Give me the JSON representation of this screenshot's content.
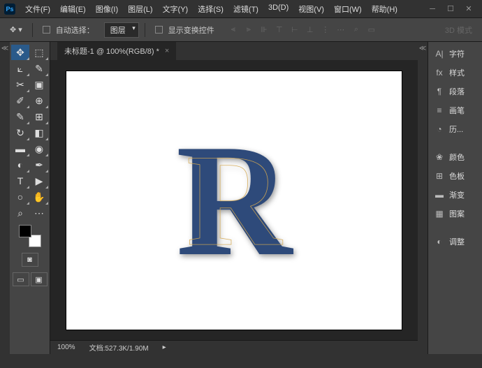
{
  "app": {
    "logo": "Ps"
  },
  "menu": {
    "file": "文件(F)",
    "edit": "编辑(E)",
    "image": "图像(I)",
    "layer": "图层(L)",
    "type": "文字(Y)",
    "select": "选择(S)",
    "filter": "滤镜(T)",
    "three_d": "3D(D)",
    "view": "视图(V)",
    "window": "窗口(W)",
    "help": "帮助(H)"
  },
  "options": {
    "auto_select": "自动选择：",
    "layer_dropdown": "图层",
    "show_transform": "显示变换控件",
    "three_d_mode": "3D 模式"
  },
  "document": {
    "tab_title": "未标题-1 @ 100%(RGB/8) *",
    "letter": "R"
  },
  "status": {
    "zoom": "100%",
    "doc_info": "文档:527.3K/1.90M"
  },
  "panels": {
    "character": "字符",
    "styles": "样式",
    "paragraph": "段落",
    "brushes": "画笔",
    "history": "历...",
    "color": "颜色",
    "swatches": "色板",
    "gradient": "渐变",
    "patterns": "图案",
    "adjustments": "调整"
  }
}
